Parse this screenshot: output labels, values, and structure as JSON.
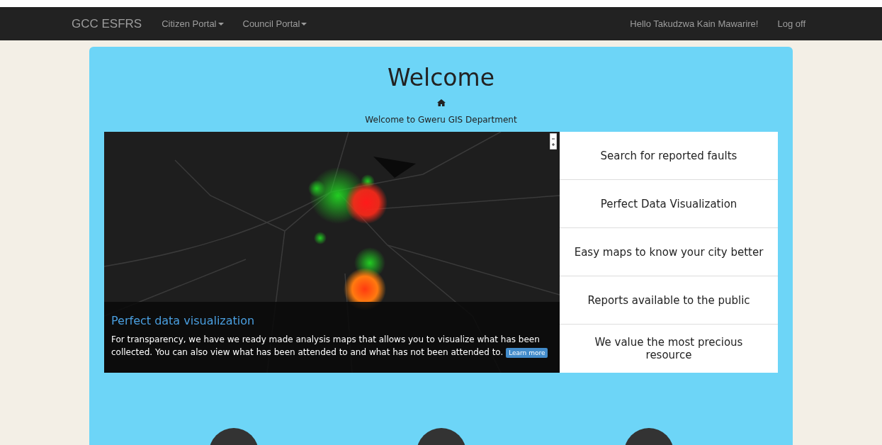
{
  "navbar": {
    "brand": "GCC ESFRS",
    "menus": [
      {
        "label": "Citizen Portal"
      },
      {
        "label": "Council Portal"
      }
    ],
    "greeting": "Hello Takudzwa Kain Mawarire!",
    "logout": "Log off"
  },
  "hero": {
    "title": "Welcome",
    "subtitle": "Welcome to Gweru GIS Department"
  },
  "carousel": {
    "caption_title": "Perfect data visualization",
    "caption_text": "For transparency, we have we ready made analysis maps that allows you to visualize what has been collected. You can also view what has been attended to and what has not been attended to.",
    "button": "Learn more"
  },
  "features": [
    {
      "label": "Search for reported faults"
    },
    {
      "label": "Perfect Data Visualization"
    },
    {
      "label": "Easy maps to know your city better"
    },
    {
      "label": "Reports available to the public"
    },
    {
      "label": "We value the most precious resource"
    }
  ]
}
